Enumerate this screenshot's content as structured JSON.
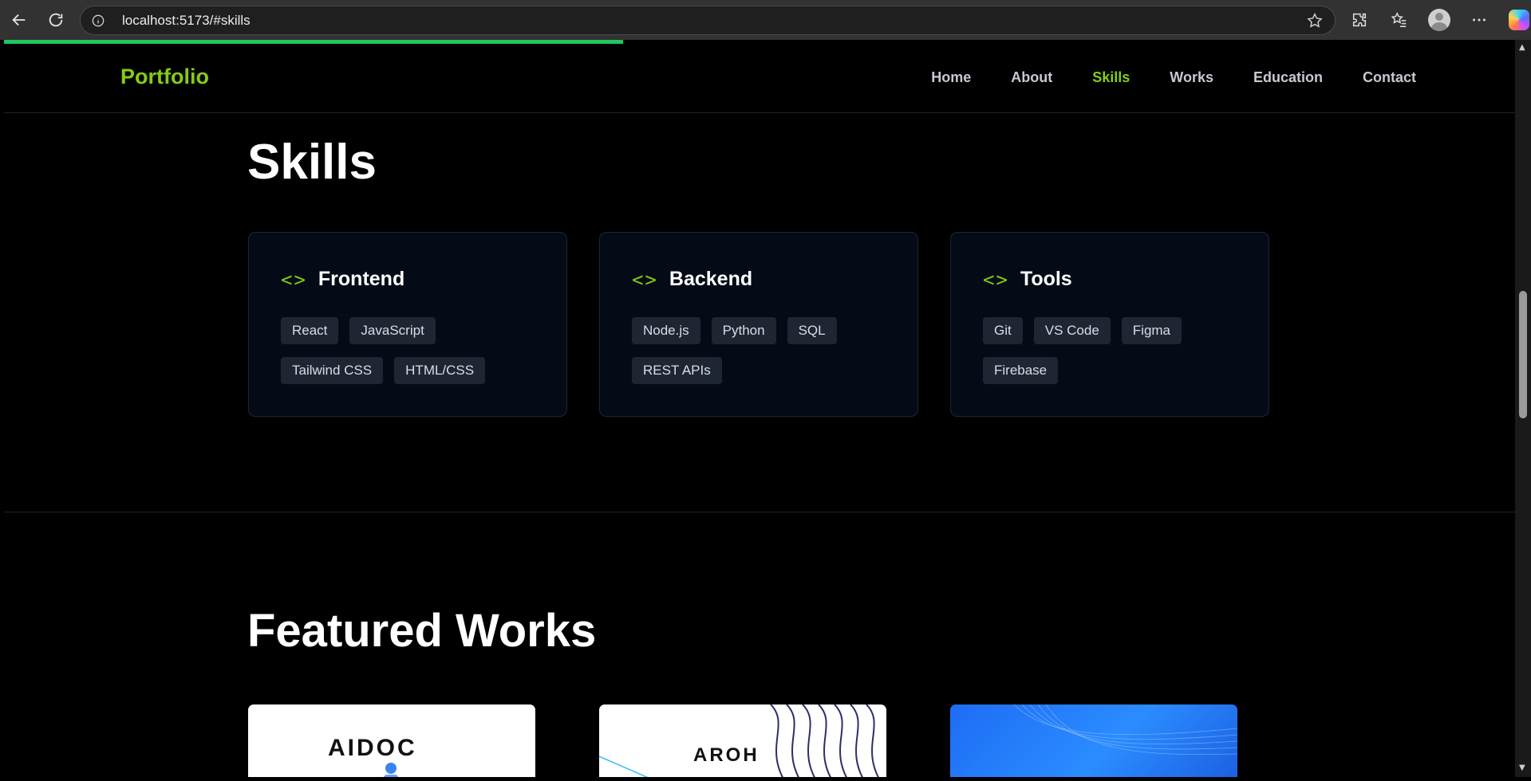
{
  "browser": {
    "url": "localhost:5173/#skills"
  },
  "site": {
    "logo": "Portfolio",
    "nav": [
      {
        "label": "Home",
        "active": false
      },
      {
        "label": "About",
        "active": false
      },
      {
        "label": "Skills",
        "active": true
      },
      {
        "label": "Works",
        "active": false
      },
      {
        "label": "Education",
        "active": false
      },
      {
        "label": "Contact",
        "active": false
      }
    ],
    "colors": {
      "accent": "#84cc16",
      "progress": "#22c55e",
      "card_bg": "#050b16",
      "tag_bg": "#1e2533"
    }
  },
  "skills": {
    "title": "Skills",
    "cards": [
      {
        "title": "Frontend",
        "tags": [
          "React",
          "JavaScript",
          "Tailwind CSS",
          "HTML/CSS"
        ]
      },
      {
        "title": "Backend",
        "tags": [
          "Node.js",
          "Python",
          "SQL",
          "REST APIs"
        ]
      },
      {
        "title": "Tools",
        "tags": [
          "Git",
          "VS Code",
          "Figma",
          "Firebase"
        ]
      }
    ]
  },
  "works": {
    "title": "Featured Works",
    "thumbnails": [
      {
        "label": "AIDOC"
      },
      {
        "label": "AROH"
      },
      {
        "label": ""
      }
    ]
  }
}
